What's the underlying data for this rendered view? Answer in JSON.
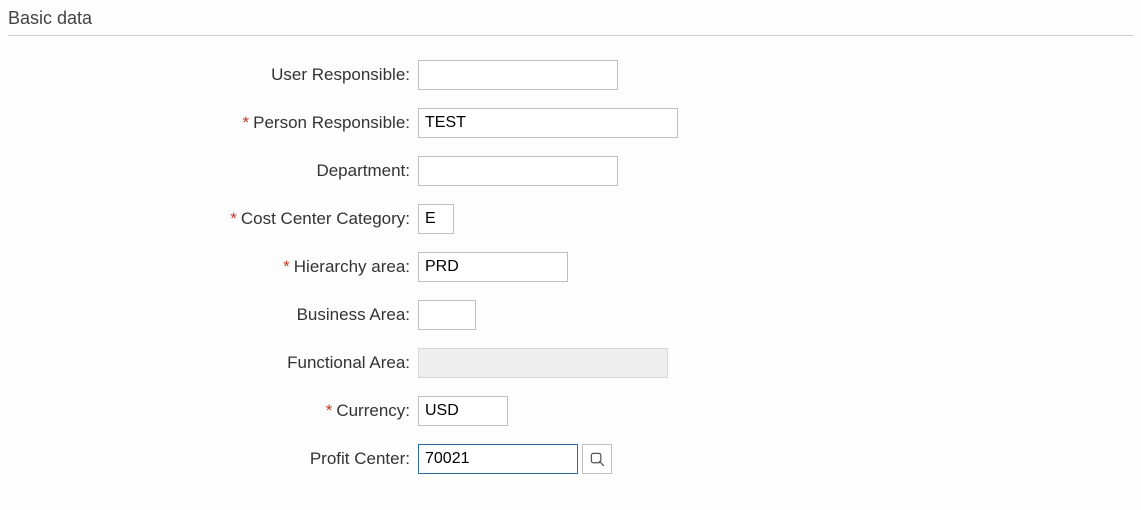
{
  "section": {
    "title": "Basic data"
  },
  "fields": {
    "user_responsible": {
      "label": "User Responsible:",
      "value": "",
      "required": false
    },
    "person_responsible": {
      "label": "Person Responsible:",
      "value": "TEST",
      "required": true
    },
    "department": {
      "label": "Department:",
      "value": "",
      "required": false
    },
    "cost_center_category": {
      "label": "Cost Center Category:",
      "value": "E",
      "required": true
    },
    "hierarchy_area": {
      "label": "Hierarchy area:",
      "value": "PRD",
      "required": true
    },
    "business_area": {
      "label": "Business Area:",
      "value": "",
      "required": false
    },
    "functional_area": {
      "label": "Functional Area:",
      "value": "",
      "required": false
    },
    "currency": {
      "label": "Currency:",
      "value": "USD",
      "required": true
    },
    "profit_center": {
      "label": "Profit Center:",
      "value": "70021",
      "required": false
    }
  }
}
